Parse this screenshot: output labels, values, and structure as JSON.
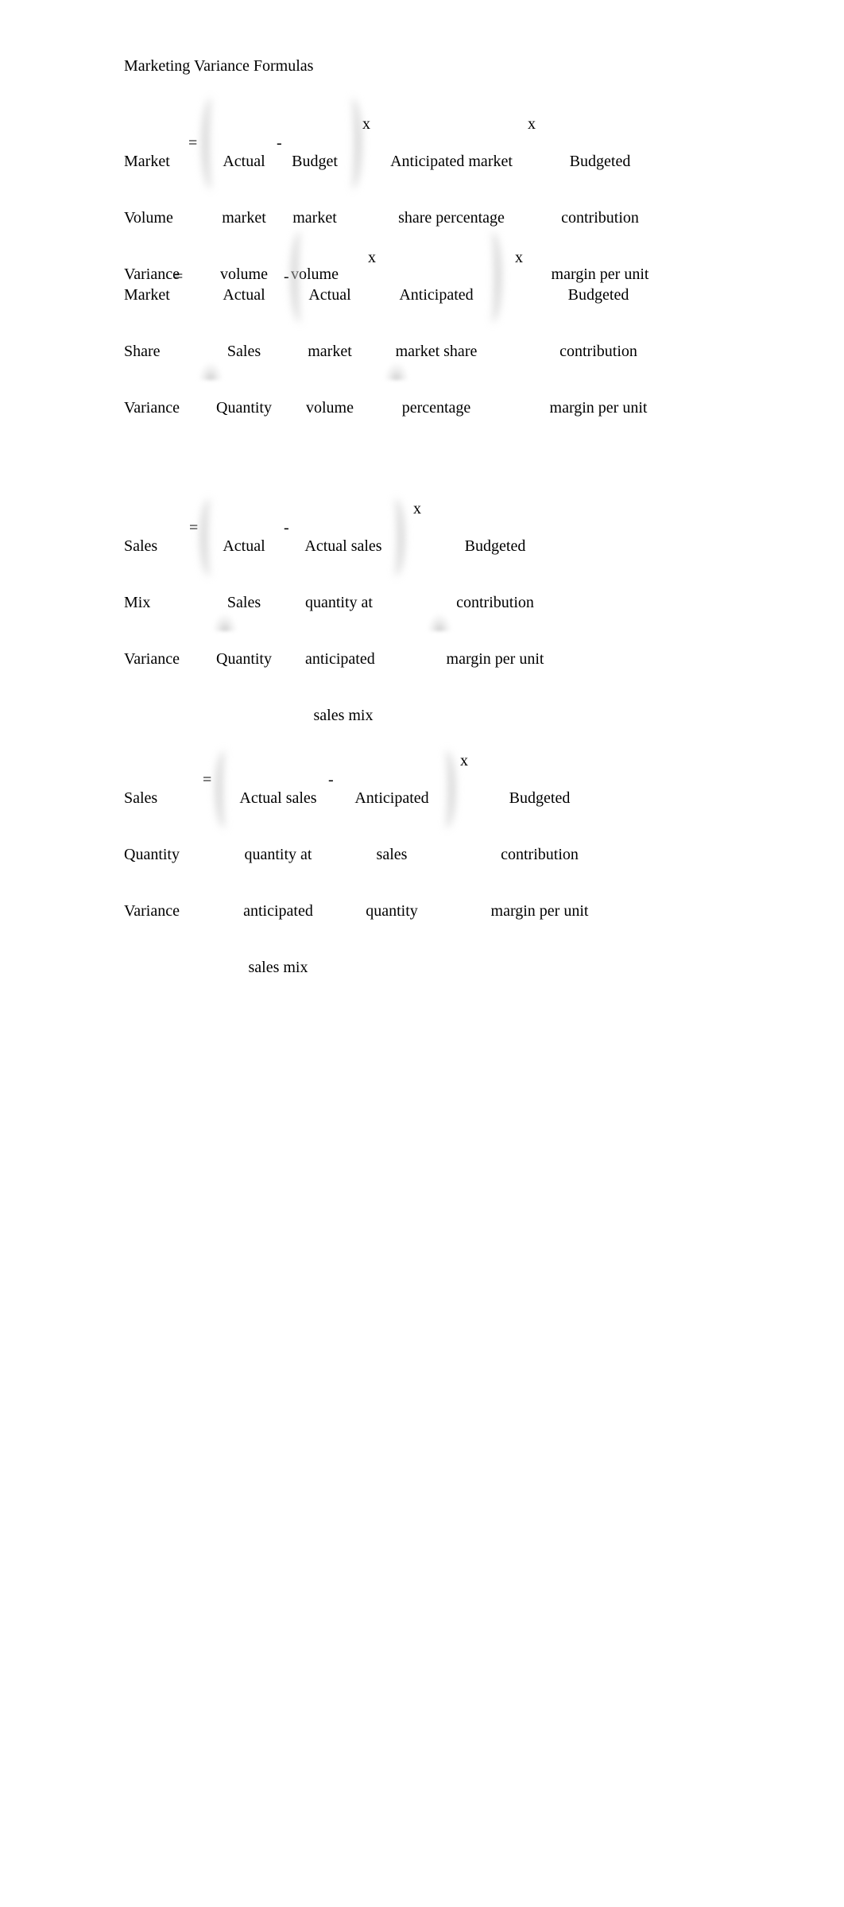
{
  "document": {
    "title": "Marketing Variance Formulas",
    "colors": {
      "text": "#000000",
      "background": "#ffffff",
      "bracket": "#c8c8c8"
    },
    "formulas": [
      {
        "name": "Market Volume Variance",
        "label_lines": [
          "Market",
          "Volume",
          "Variance"
        ],
        "equals": "=",
        "term_a_lines": [
          "Actual",
          "market",
          "volume"
        ],
        "minus": "-",
        "term_b_lines": [
          "Budget",
          "market",
          "volume"
        ],
        "times_1": "x",
        "factor_1_lines": [
          "Anticipated market",
          "share percentage"
        ],
        "times_2": "x",
        "factor_2_lines": [
          "Budgeted",
          "contribution",
          "margin per unit"
        ]
      },
      {
        "name": "Market Share Variance",
        "label_lines": [
          "Market",
          "Share",
          "Variance"
        ],
        "equals": "=",
        "term_a_lines": [
          "Actual",
          "Sales",
          "Quantity"
        ],
        "minus": "-",
        "term_b_lines": [
          "Actual",
          "market",
          "volume"
        ],
        "times_1": "x",
        "factor_1_lines": [
          "Anticipated",
          "market share",
          "percentage"
        ],
        "times_2": "x",
        "factor_2_lines": [
          "Budgeted",
          "contribution",
          "margin per unit"
        ]
      },
      {
        "name": "Sales Mix Variance",
        "label_lines": [
          "Sales",
          "Mix",
          "Variance"
        ],
        "equals": "=",
        "term_a_lines": [
          "Actual",
          "Sales",
          "Quantity"
        ],
        "minus": "-",
        "term_b_lines": [
          "Actual sales",
          "quantity at",
          "anticipated",
          "sales mix"
        ],
        "times_1": "x",
        "factor_2_lines": [
          "Budgeted",
          "contribution",
          "margin per unit"
        ]
      },
      {
        "name": "Sales Quantity Variance",
        "label_lines": [
          "Sales",
          "Quantity",
          "Variance"
        ],
        "equals": "=",
        "term_a_lines": [
          "Actual sales",
          "quantity at",
          "anticipated",
          "sales mix"
        ],
        "minus": "-",
        "term_b_lines": [
          "Anticipated",
          "sales",
          "quantity"
        ],
        "times_1": "x",
        "factor_2_lines": [
          "Budgeted",
          "contribution",
          "margin per unit"
        ]
      }
    ]
  }
}
